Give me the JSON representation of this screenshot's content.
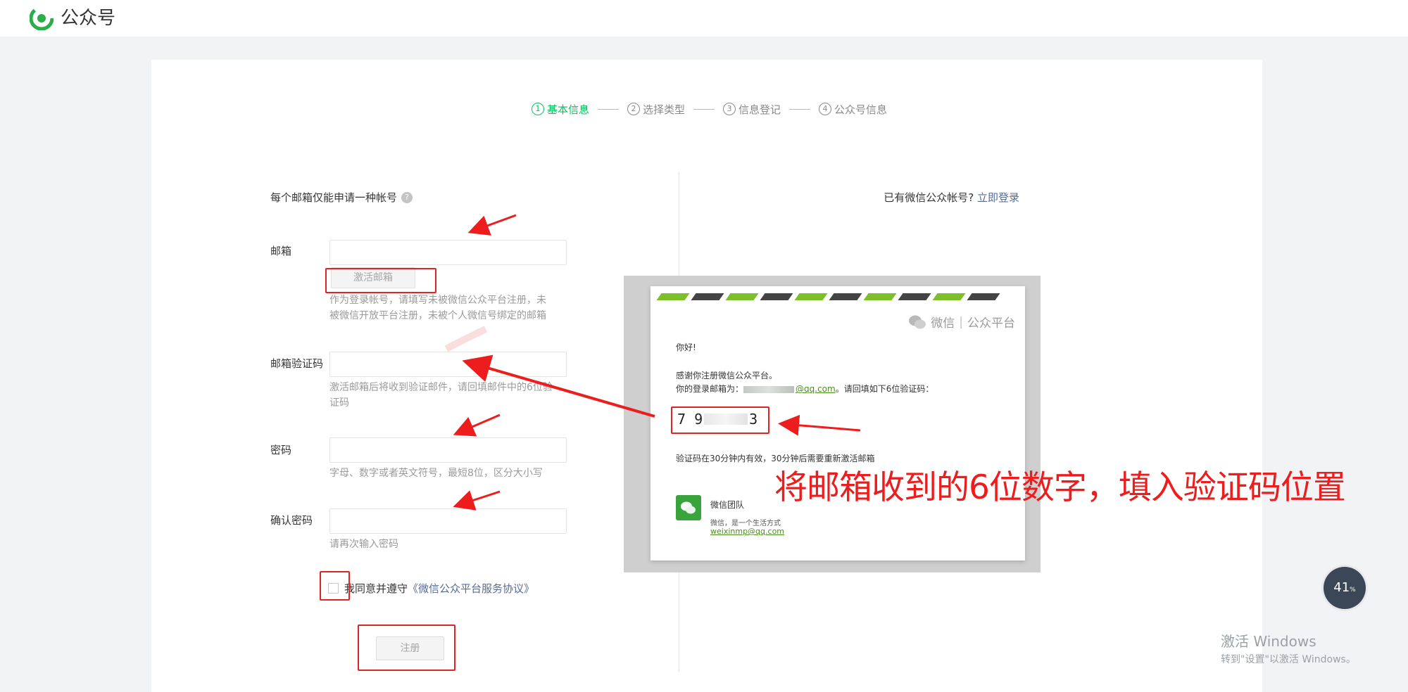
{
  "header": {
    "logo_text": "公众号",
    "logo_icon": "wechat-mp-logo-icon"
  },
  "steps": [
    {
      "num": "1",
      "label": "基本信息",
      "active": true
    },
    {
      "num": "2",
      "label": "选择类型",
      "active": false
    },
    {
      "num": "3",
      "label": "信息登记",
      "active": false
    },
    {
      "num": "4",
      "label": "公众号信息",
      "active": false
    }
  ],
  "form": {
    "notice": "每个邮箱仅能申请一种帐号",
    "email_label": "邮箱",
    "email_value": "",
    "activate_button": "激活邮箱",
    "email_hint": "作为登录帐号，请填写未被微信公众平台注册，未被微信开放平台注册，未被个人微信号绑定的邮箱",
    "code_label": "邮箱验证码",
    "code_value": "",
    "code_hint": "激活邮箱后将收到验证邮件，请回填邮件中的6位验证码",
    "password_label": "密码",
    "password_value": "",
    "password_hint": "字母、数字或者英文符号，最短8位，区分大小写",
    "confirm_label": "确认密码",
    "confirm_value": "",
    "confirm_hint": "请再次输入密码",
    "agree_text": "我同意并遵守",
    "agree_link": "《微信公众平台服务协议》",
    "register_button": "注册"
  },
  "login": {
    "text": "已有微信公众帐号?",
    "link": "立即登录"
  },
  "email_preview": {
    "brand_wechat": "微信",
    "brand_platform": "公众平台",
    "greeting": "你好!",
    "thanks": "感谢你注册微信公众平台。",
    "account_prefix": "你的登录邮箱为：",
    "account_domain": "@qq.com",
    "account_suffix": "。请回填如下6位验证码：",
    "code_first": "7 9",
    "code_last": "3",
    "validity": "验证码在30分钟内有效，30分钟后需要重新激活邮箱",
    "team_name": "微信团队",
    "team_slogan": "微信，是一个生活方式",
    "team_email": "weixinmp@qq.com"
  },
  "annotation": "将邮箱收到的6位数字，填入验证码位置",
  "progress_widget": {
    "value": "41",
    "unit": "%"
  },
  "windows_watermark": {
    "title": "激活 Windows",
    "subtitle": "转到\"设置\"以激活 Windows。"
  },
  "colors": {
    "accent_green": "#07c160",
    "link_blue": "#576b95",
    "annotation_red": "#ee1d1d"
  }
}
